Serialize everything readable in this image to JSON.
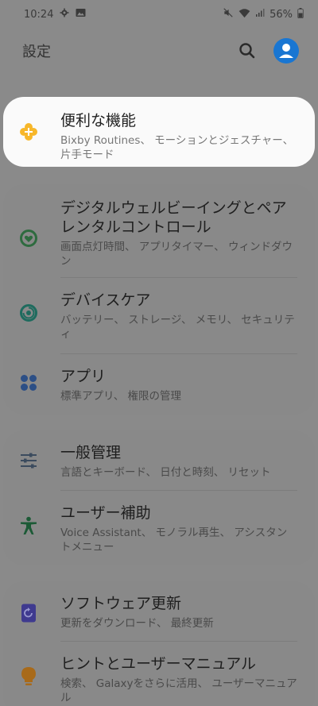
{
  "status_bar": {
    "time": "10:24",
    "battery": "56%"
  },
  "header": {
    "title": "設定"
  },
  "items": [
    {
      "title": "便利な機能",
      "subtitle": "Bixby Routines、 モーションとジェスチャー、 片手モード",
      "icon": "plus-flower-icon",
      "color": "#f7b72a"
    },
    {
      "title": "デジタルウェルビーイングとペアレンタルコントロール",
      "subtitle": "画面点灯時間、 アプリタイマー、 ウィンドダウン",
      "icon": "heart-circle-icon",
      "color": "#2e6b3f"
    },
    {
      "title": "デバイスケア",
      "subtitle": "バッテリー、 ストレージ、 メモリ、 セキュリティ",
      "icon": "device-care-icon",
      "color": "#1e6b5e"
    },
    {
      "title": "アプリ",
      "subtitle": "標準アプリ、 権限の管理",
      "icon": "apps-dots-icon",
      "color": "#2c4f86"
    },
    {
      "title": "一般管理",
      "subtitle": "言語とキーボード、 日付と時刻、 リセット",
      "icon": "sliders-icon",
      "color": "#3b4b5e"
    },
    {
      "title": "ユーザー補助",
      "subtitle": "Voice Assistant、 モノラル再生、 アシスタントメニュー",
      "icon": "accessibility-icon",
      "color": "#1c5a36"
    },
    {
      "title": "ソフトウェア更新",
      "subtitle": "更新をダウンロード、 最終更新",
      "icon": "software-update-icon",
      "color": "#3f3a8f"
    },
    {
      "title": "ヒントとユーザーマニュアル",
      "subtitle": "検索、 Galaxyをさらに活用、 ユーザーマニュアル",
      "icon": "lightbulb-icon",
      "color": "#a86a1a"
    }
  ]
}
